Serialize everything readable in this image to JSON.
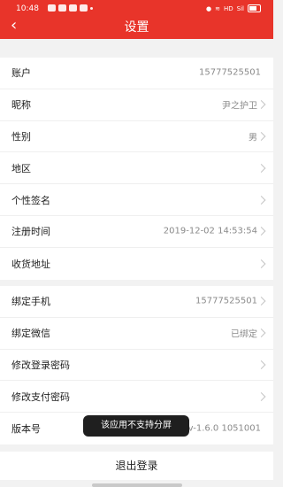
{
  "status_bar": {
    "time": "10:48",
    "hd": "HD",
    "signal": "Sil"
  },
  "header": {
    "title": "设置",
    "back_icon": "‹"
  },
  "profile_group": [
    {
      "label": "账户",
      "value": "15777525501",
      "has_arrow": false
    },
    {
      "label": "昵称",
      "value": "尹之护卫",
      "has_arrow": true
    },
    {
      "label": "性别",
      "value": "男",
      "has_arrow": true
    },
    {
      "label": "地区",
      "value": "",
      "has_arrow": true
    },
    {
      "label": "个性签名",
      "value": "",
      "has_arrow": true
    },
    {
      "label": "注册时间",
      "value": "2019-12-02 14:53:54",
      "has_arrow": true
    },
    {
      "label": "收货地址",
      "value": "",
      "has_arrow": true
    }
  ],
  "account_group": [
    {
      "label": "绑定手机",
      "value": "15777525501",
      "has_arrow": true
    },
    {
      "label": "绑定微信",
      "value": "已绑定",
      "has_arrow": true
    },
    {
      "label": "修改登录密码",
      "value": "",
      "has_arrow": true
    },
    {
      "label": "修改支付密码",
      "value": "",
      "has_arrow": true
    },
    {
      "label": "版本号",
      "value": "v-1.6.0  1051001",
      "has_arrow": false
    }
  ],
  "toast": "该应用不支持分屏",
  "logout_label": "退出登录",
  "colors": {
    "header": "#e8342a",
    "background": "#f2f2f2"
  }
}
